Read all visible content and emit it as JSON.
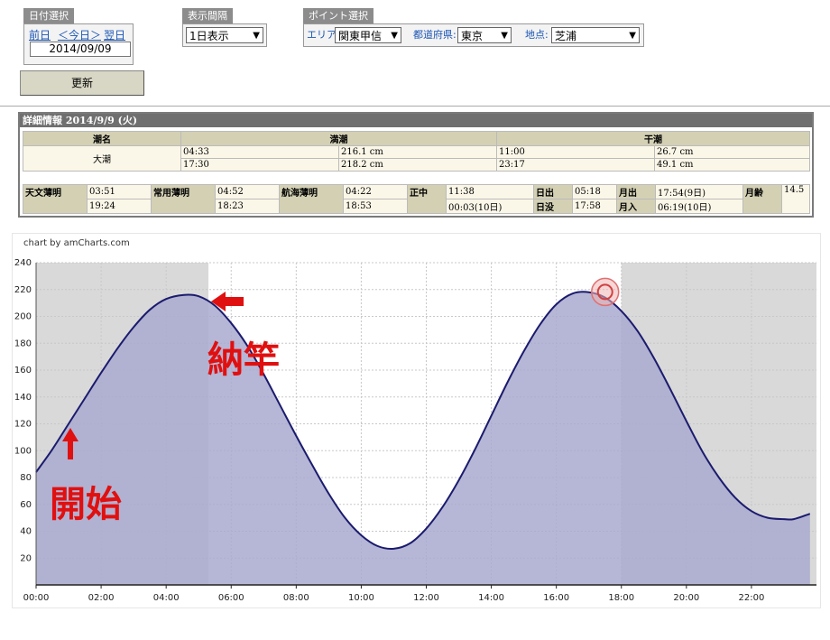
{
  "date_panel": {
    "title": "日付選択",
    "prev": "前日",
    "today": "＜今日＞",
    "next": "翌日",
    "date": "2014/09/09"
  },
  "interval_panel": {
    "title": "表示間隔",
    "selected": "1日表示"
  },
  "point_panel": {
    "title": "ポイント選択",
    "area_label": "エリア:",
    "area_value": "関東甲信",
    "pref_label": "都道府県:",
    "pref_value": "東京",
    "place_label": "地点:",
    "place_value": "芝浦"
  },
  "update_button": "更新",
  "detail": {
    "title": "詳細情報  2014/9/9 (火)",
    "tide_name_header": "潮名",
    "high_header": "満潮",
    "low_header": "干潮",
    "tide_name": "大潮",
    "high": [
      {
        "time": "04:33",
        "level": "216.1 cm"
      },
      {
        "time": "17:30",
        "level": "218.2 cm"
      }
    ],
    "low": [
      {
        "time": "11:00",
        "level": "26.7 cm"
      },
      {
        "time": "23:17",
        "level": "49.1 cm"
      }
    ],
    "astro": {
      "astro_twilight_label": "天文薄明",
      "astro_twilight": [
        "03:51",
        "19:24"
      ],
      "civil_twilight_label": "常用薄明",
      "civil_twilight": [
        "04:52",
        "18:23"
      ],
      "nautical_twilight_label": "航海薄明",
      "nautical_twilight": [
        "04:22",
        "18:53"
      ],
      "noon_label": "正中",
      "noon": [
        "11:38",
        "00:03(10日)"
      ],
      "sunrise_label": "日出",
      "sunrise": "05:18",
      "sunset_label": "日没",
      "sunset": "17:58",
      "moonrise_label": "月出",
      "moonrise": "17:54(9日)",
      "moonset_label": "月入",
      "moonset": "06:19(10日)",
      "moon_age_label": "月齢",
      "moon_age": "14.5"
    }
  },
  "chart_credit": "chart by amCharts.com",
  "annotations": {
    "start": "開始",
    "end": "納竿",
    "arrow_color": "#e01010"
  },
  "chart_data": {
    "type": "area",
    "title": "",
    "xlabel": "",
    "ylabel": "",
    "xlim": [
      0,
      24
    ],
    "ylim": [
      0,
      240
    ],
    "x_ticks": [
      "00:00",
      "02:00",
      "04:00",
      "06:00",
      "08:00",
      "10:00",
      "12:00",
      "14:00",
      "16:00",
      "18:00",
      "20:00",
      "22:00"
    ],
    "y_ticks": [
      20,
      40,
      60,
      80,
      100,
      120,
      140,
      160,
      180,
      200,
      220,
      240
    ],
    "x": [
      0,
      0.5,
      1,
      1.5,
      2,
      2.5,
      3,
      3.5,
      4,
      4.55,
      5,
      5.5,
      6,
      6.5,
      7,
      7.5,
      8,
      8.5,
      9,
      9.5,
      10,
      10.5,
      11,
      11.5,
      12,
      12.5,
      13,
      13.5,
      14,
      14.5,
      15,
      15.5,
      16,
      16.5,
      17,
      17.5,
      18,
      18.5,
      19,
      19.5,
      20,
      20.5,
      21,
      21.5,
      22,
      22.5,
      23,
      23.3,
      23.8
    ],
    "y": [
      84,
      101,
      120,
      139,
      158,
      176,
      192,
      205,
      213,
      216,
      215,
      208,
      195,
      178,
      157,
      134,
      111,
      89,
      68,
      50,
      37,
      29,
      27,
      31,
      42,
      58,
      78,
      101,
      126,
      151,
      174,
      194,
      209,
      217,
      218,
      214,
      204,
      189,
      169,
      146,
      122,
      99,
      80,
      65,
      55,
      50,
      49,
      49,
      53
    ],
    "shaded_ranges": [
      [
        0,
        5.3
      ],
      [
        18,
        24
      ]
    ],
    "line_color": "#1b1b6e",
    "fill_color": "#a9a9cf",
    "shade_color": "#d9d9d9",
    "highlight_point": {
      "x": 17.5,
      "y": 218.2
    }
  }
}
